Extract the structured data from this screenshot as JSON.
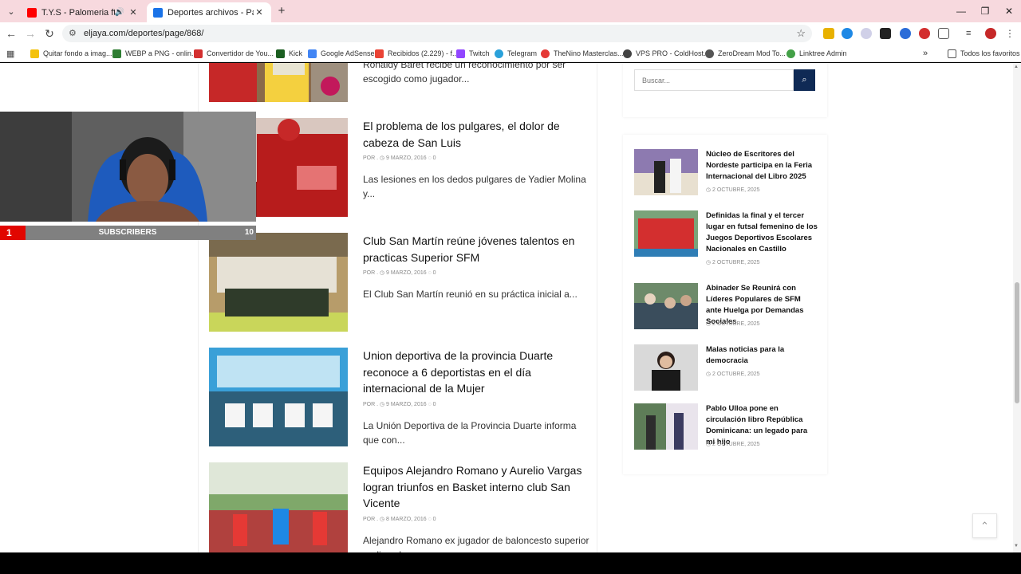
{
  "browser": {
    "tabs": [
      {
        "title": "T.Y.S - Palomeria ft. Lapiz Co",
        "favicon_color": "#ff0000",
        "active": false
      },
      {
        "title": "Deportes archivos - Página 868",
        "favicon_color": "#1a73e8",
        "active": true
      }
    ],
    "new_tab": "+",
    "window_controls": [
      "—",
      "❐",
      "✕"
    ],
    "url": "eljaya.com/deportes/page/868/",
    "bookmarks": [
      {
        "label": "Quitar fondo a imag...",
        "color": "#f4c20d"
      },
      {
        "label": "WEBP a PNG - onlin...",
        "color": "#2e7d32"
      },
      {
        "label": "Convertidor de You...",
        "color": "#d32f2f"
      },
      {
        "label": "Kick",
        "color": "#1b5e20"
      },
      {
        "label": "Google AdSense",
        "color": "#4285f4"
      },
      {
        "label": "Recibidos (2.229) - f...",
        "color": "#ea4335"
      },
      {
        "label": "Twitch",
        "color": "#9146ff"
      },
      {
        "label": "Telegram",
        "color": "#2aa1da"
      },
      {
        "label": "TheNino Masterclas...",
        "color": "#e53935"
      },
      {
        "label": "VPS PRO - ColdHost...",
        "color": "#424242"
      },
      {
        "label": "ZeroDream Mod To...",
        "color": "#555555"
      },
      {
        "label": "Linktree Admin",
        "color": "#43a047"
      }
    ],
    "all_bookmarks": "Todos los favoritos"
  },
  "articles": [
    {
      "title": "",
      "meta": "",
      "excerpt": "Ronaldy Baret recibe un reconocimiento por ser escogido como jugador..."
    },
    {
      "title": "El problema de los pulgares, el dolor de cabeza de San Luis",
      "meta": "POR . ◷ 9 MARZO, 2016 ◌ 0",
      "excerpt": "Las lesiones en los dedos pulgares de Yadier Molina y..."
    },
    {
      "title": "Club San Martín reúne jóvenes talentos en practicas Superior SFM",
      "meta": "POR . ◷ 9 MARZO, 2016 ◌ 0",
      "excerpt": "El Club San Martín reunió en su práctica inicial a..."
    },
    {
      "title": "Union deportiva de la provincia Duarte reconoce a 6 deportistas en el día internacional de la Mujer",
      "meta": "POR . ◷ 9 MARZO, 2016 ◌ 0",
      "excerpt": "La Unión Deportiva de la Provincia Duarte informa que con..."
    },
    {
      "title": "Equipos Alejandro Romano y Aurelio Vargas logran triunfos en Basket interno club San Vicente",
      "meta": "POR . ◷ 8 MARZO, 2016 ◌ 0",
      "excerpt": "Alejandro Romano ex jugador de baloncesto superior realizo el saque..."
    }
  ],
  "sidebar": {
    "search_placeholder": "Buscar...",
    "posts": [
      {
        "title": "Núcleo de Escritores del Nordeste participa en la Feria Internacional del Libro 2025",
        "date": "◷ 2 OCTUBRE, 2025"
      },
      {
        "title": "Definidas la final y el tercer lugar en futsal femenino de los Juegos Deportivos Escolares Nacionales en Castillo",
        "date": "◷ 2 OCTUBRE, 2025"
      },
      {
        "title": "Abinader Se Reunirá con Líderes Populares de SFM ante Huelga por Demandas Sociales",
        "date": "◷ 2 OCTUBRE, 2025"
      },
      {
        "title": "Malas noticias para la democracia",
        "date": "◷ 2 OCTUBRE, 2025"
      },
      {
        "title": "Pablo Ulloa pone en circulación libro República Dominicana: un legado para mi hijo",
        "date": "◷ 2 OCTUBRE, 2025"
      }
    ]
  },
  "overlay": {
    "sub_count": "1",
    "sub_label": "SUBSCRIBERS",
    "sub_goal": "10"
  }
}
